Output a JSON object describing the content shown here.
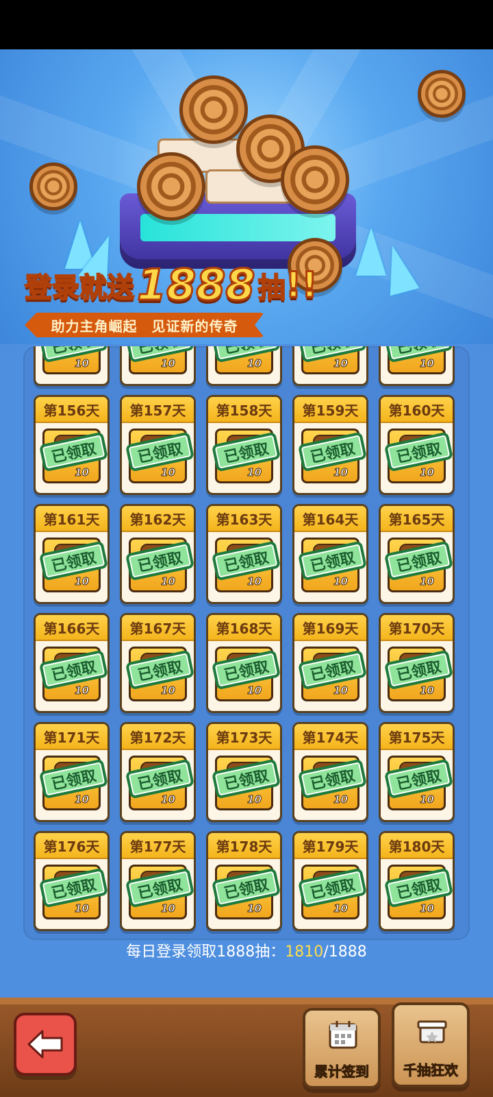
{
  "banner": {
    "title_pre": "登录就送",
    "title_num": "1888",
    "title_post": "抽",
    "title_ex": "!!",
    "subtitle": "助力主角崛起　见证新的传奇"
  },
  "days": {
    "partial_row": [
      {
        "count": "10"
      },
      {
        "count": "10"
      },
      {
        "count": "10"
      },
      {
        "count": "10"
      },
      {
        "count": "10"
      }
    ],
    "items": [
      {
        "label": "第156天",
        "count": "10"
      },
      {
        "label": "第157天",
        "count": "10"
      },
      {
        "label": "第158天",
        "count": "10"
      },
      {
        "label": "第159天",
        "count": "10"
      },
      {
        "label": "第160天",
        "count": "10"
      },
      {
        "label": "第161天",
        "count": "10"
      },
      {
        "label": "第162天",
        "count": "10"
      },
      {
        "label": "第163天",
        "count": "10"
      },
      {
        "label": "第164天",
        "count": "10"
      },
      {
        "label": "第165天",
        "count": "10"
      },
      {
        "label": "第166天",
        "count": "10"
      },
      {
        "label": "第167天",
        "count": "10"
      },
      {
        "label": "第168天",
        "count": "10"
      },
      {
        "label": "第169天",
        "count": "10"
      },
      {
        "label": "第170天",
        "count": "10"
      },
      {
        "label": "第171天",
        "count": "10"
      },
      {
        "label": "第172天",
        "count": "10"
      },
      {
        "label": "第173天",
        "count": "10"
      },
      {
        "label": "第174天",
        "count": "10"
      },
      {
        "label": "第175天",
        "count": "10"
      },
      {
        "label": "第176天",
        "count": "10"
      },
      {
        "label": "第177天",
        "count": "10"
      },
      {
        "label": "第178天",
        "count": "10"
      },
      {
        "label": "第179天",
        "count": "10"
      },
      {
        "label": "第180天",
        "count": "10"
      }
    ],
    "claimed_stamp": "已领取"
  },
  "progress": {
    "label": "每日登录领取1888抽：",
    "current": "1810",
    "sep_total": "/1888"
  },
  "footer": {
    "back_icon": "back-arrow-icon",
    "cumulative_label": "累计签到",
    "carnival_label": "千抽狂欢"
  },
  "colors": {
    "background": "#4f8fdf",
    "card_header": "#f4b41c",
    "stamp_green": "#8fe39a",
    "progress_highlight": "#ffdc4a"
  }
}
